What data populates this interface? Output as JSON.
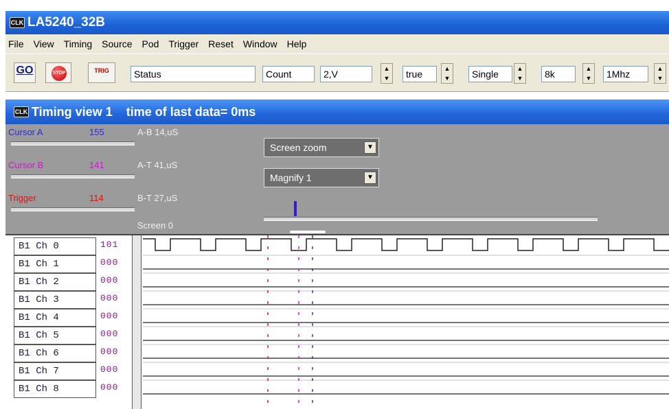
{
  "window": {
    "title": "LA5240_32B",
    "icon_text": "CLK"
  },
  "menu": [
    "File",
    "View",
    "Timing",
    "Source",
    "Pod",
    "Trigger",
    "Reset",
    "Window",
    "Help"
  ],
  "toolbar": {
    "go_label": "GO",
    "stop_label": "STOP",
    "trig_label": "TRIG",
    "status_value": "Status",
    "count_value": "Count",
    "voltage_value": "2,V",
    "bool_value": "true",
    "mode_value": "Single",
    "depth_value": "8k",
    "rate_value": "1Mhz"
  },
  "timing_view": {
    "title": "Timing view  1",
    "subtitle": "time of last data= 0ms",
    "icon_text": "CLK",
    "cursor_a": {
      "label": "Cursor A",
      "value": "155",
      "color": "#2b2bd0"
    },
    "cursor_b": {
      "label": "Cursor B",
      "value": "141",
      "color": "#c020c0"
    },
    "trigger": {
      "label": "Trigger",
      "value": "114",
      "color": "#d01818"
    },
    "ab": "A-B  14,uS",
    "at": "A-T  41,uS",
    "bt": "B-T  27,uS",
    "screen": "Screen  0",
    "screen_zoom": "Screen zoom",
    "magnify": "Magnify 1"
  },
  "channels": [
    {
      "label": "B1 Ch 0",
      "value": "101"
    },
    {
      "label": "B1 Ch 1",
      "value": "000"
    },
    {
      "label": "B1 Ch 2",
      "value": "000"
    },
    {
      "label": "B1 Ch 3",
      "value": "000"
    },
    {
      "label": "B1 Ch 4",
      "value": "000"
    },
    {
      "label": "B1 Ch 5",
      "value": "000"
    },
    {
      "label": "B1 Ch 6",
      "value": "000"
    },
    {
      "label": "B1 Ch 7",
      "value": "000"
    },
    {
      "label": "B1 Ch 8",
      "value": "000"
    }
  ],
  "colors": {
    "cursor_a": "#2b2bd0",
    "cursor_b": "#c020c0",
    "trigger": "#d01818",
    "titlebar": "#1d62d6"
  }
}
